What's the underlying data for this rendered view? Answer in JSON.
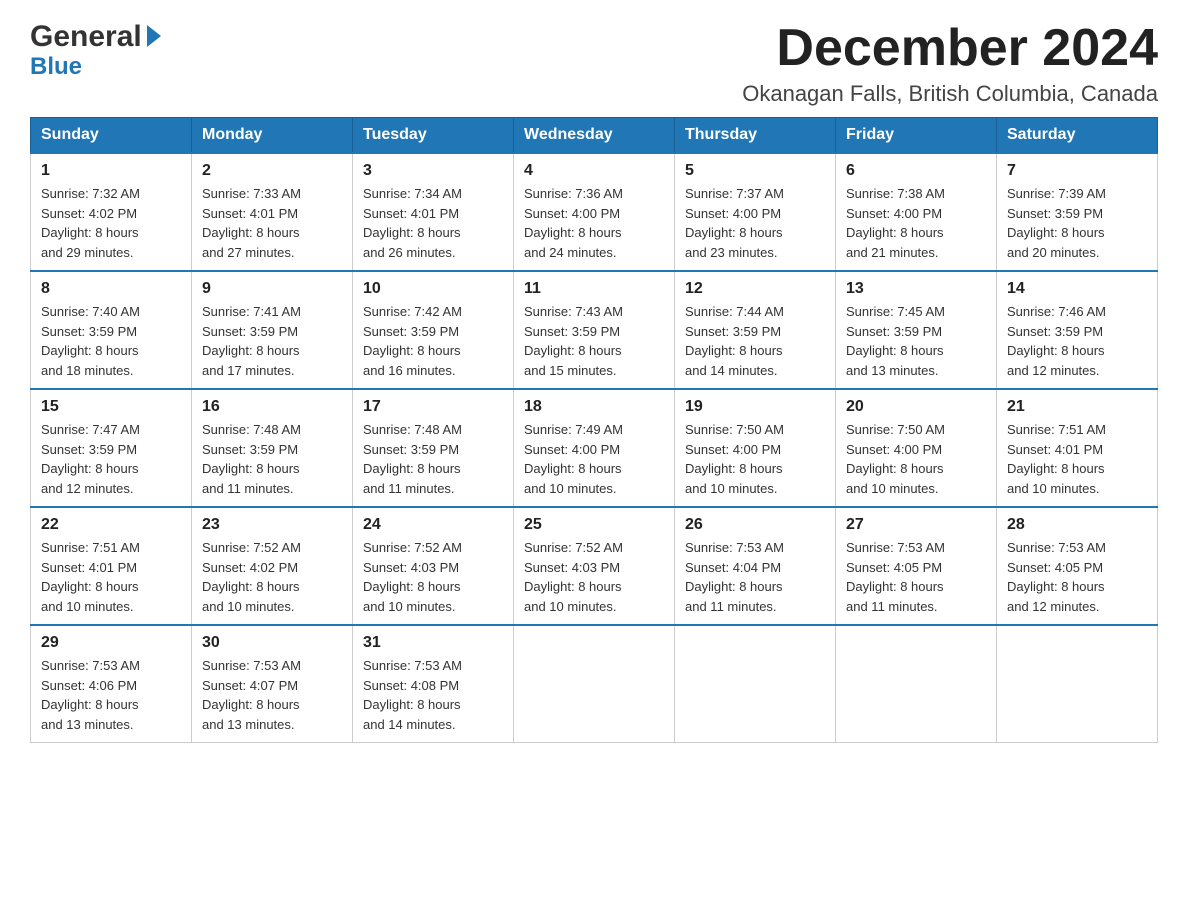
{
  "header": {
    "logo_general": "General",
    "logo_blue": "Blue",
    "month_title": "December 2024",
    "location": "Okanagan Falls, British Columbia, Canada"
  },
  "days_of_week": [
    "Sunday",
    "Monday",
    "Tuesday",
    "Wednesday",
    "Thursday",
    "Friday",
    "Saturday"
  ],
  "weeks": [
    [
      {
        "day": "1",
        "sunrise": "7:32 AM",
        "sunset": "4:02 PM",
        "daylight": "8 hours and 29 minutes."
      },
      {
        "day": "2",
        "sunrise": "7:33 AM",
        "sunset": "4:01 PM",
        "daylight": "8 hours and 27 minutes."
      },
      {
        "day": "3",
        "sunrise": "7:34 AM",
        "sunset": "4:01 PM",
        "daylight": "8 hours and 26 minutes."
      },
      {
        "day": "4",
        "sunrise": "7:36 AM",
        "sunset": "4:00 PM",
        "daylight": "8 hours and 24 minutes."
      },
      {
        "day": "5",
        "sunrise": "7:37 AM",
        "sunset": "4:00 PM",
        "daylight": "8 hours and 23 minutes."
      },
      {
        "day": "6",
        "sunrise": "7:38 AM",
        "sunset": "4:00 PM",
        "daylight": "8 hours and 21 minutes."
      },
      {
        "day": "7",
        "sunrise": "7:39 AM",
        "sunset": "3:59 PM",
        "daylight": "8 hours and 20 minutes."
      }
    ],
    [
      {
        "day": "8",
        "sunrise": "7:40 AM",
        "sunset": "3:59 PM",
        "daylight": "8 hours and 18 minutes."
      },
      {
        "day": "9",
        "sunrise": "7:41 AM",
        "sunset": "3:59 PM",
        "daylight": "8 hours and 17 minutes."
      },
      {
        "day": "10",
        "sunrise": "7:42 AM",
        "sunset": "3:59 PM",
        "daylight": "8 hours and 16 minutes."
      },
      {
        "day": "11",
        "sunrise": "7:43 AM",
        "sunset": "3:59 PM",
        "daylight": "8 hours and 15 minutes."
      },
      {
        "day": "12",
        "sunrise": "7:44 AM",
        "sunset": "3:59 PM",
        "daylight": "8 hours and 14 minutes."
      },
      {
        "day": "13",
        "sunrise": "7:45 AM",
        "sunset": "3:59 PM",
        "daylight": "8 hours and 13 minutes."
      },
      {
        "day": "14",
        "sunrise": "7:46 AM",
        "sunset": "3:59 PM",
        "daylight": "8 hours and 12 minutes."
      }
    ],
    [
      {
        "day": "15",
        "sunrise": "7:47 AM",
        "sunset": "3:59 PM",
        "daylight": "8 hours and 12 minutes."
      },
      {
        "day": "16",
        "sunrise": "7:48 AM",
        "sunset": "3:59 PM",
        "daylight": "8 hours and 11 minutes."
      },
      {
        "day": "17",
        "sunrise": "7:48 AM",
        "sunset": "3:59 PM",
        "daylight": "8 hours and 11 minutes."
      },
      {
        "day": "18",
        "sunrise": "7:49 AM",
        "sunset": "4:00 PM",
        "daylight": "8 hours and 10 minutes."
      },
      {
        "day": "19",
        "sunrise": "7:50 AM",
        "sunset": "4:00 PM",
        "daylight": "8 hours and 10 minutes."
      },
      {
        "day": "20",
        "sunrise": "7:50 AM",
        "sunset": "4:00 PM",
        "daylight": "8 hours and 10 minutes."
      },
      {
        "day": "21",
        "sunrise": "7:51 AM",
        "sunset": "4:01 PM",
        "daylight": "8 hours and 10 minutes."
      }
    ],
    [
      {
        "day": "22",
        "sunrise": "7:51 AM",
        "sunset": "4:01 PM",
        "daylight": "8 hours and 10 minutes."
      },
      {
        "day": "23",
        "sunrise": "7:52 AM",
        "sunset": "4:02 PM",
        "daylight": "8 hours and 10 minutes."
      },
      {
        "day": "24",
        "sunrise": "7:52 AM",
        "sunset": "4:03 PM",
        "daylight": "8 hours and 10 minutes."
      },
      {
        "day": "25",
        "sunrise": "7:52 AM",
        "sunset": "4:03 PM",
        "daylight": "8 hours and 10 minutes."
      },
      {
        "day": "26",
        "sunrise": "7:53 AM",
        "sunset": "4:04 PM",
        "daylight": "8 hours and 11 minutes."
      },
      {
        "day": "27",
        "sunrise": "7:53 AM",
        "sunset": "4:05 PM",
        "daylight": "8 hours and 11 minutes."
      },
      {
        "day": "28",
        "sunrise": "7:53 AM",
        "sunset": "4:05 PM",
        "daylight": "8 hours and 12 minutes."
      }
    ],
    [
      {
        "day": "29",
        "sunrise": "7:53 AM",
        "sunset": "4:06 PM",
        "daylight": "8 hours and 13 minutes."
      },
      {
        "day": "30",
        "sunrise": "7:53 AM",
        "sunset": "4:07 PM",
        "daylight": "8 hours and 13 minutes."
      },
      {
        "day": "31",
        "sunrise": "7:53 AM",
        "sunset": "4:08 PM",
        "daylight": "8 hours and 14 minutes."
      },
      null,
      null,
      null,
      null
    ]
  ],
  "labels": {
    "sunrise": "Sunrise:",
    "sunset": "Sunset:",
    "daylight": "Daylight:"
  }
}
